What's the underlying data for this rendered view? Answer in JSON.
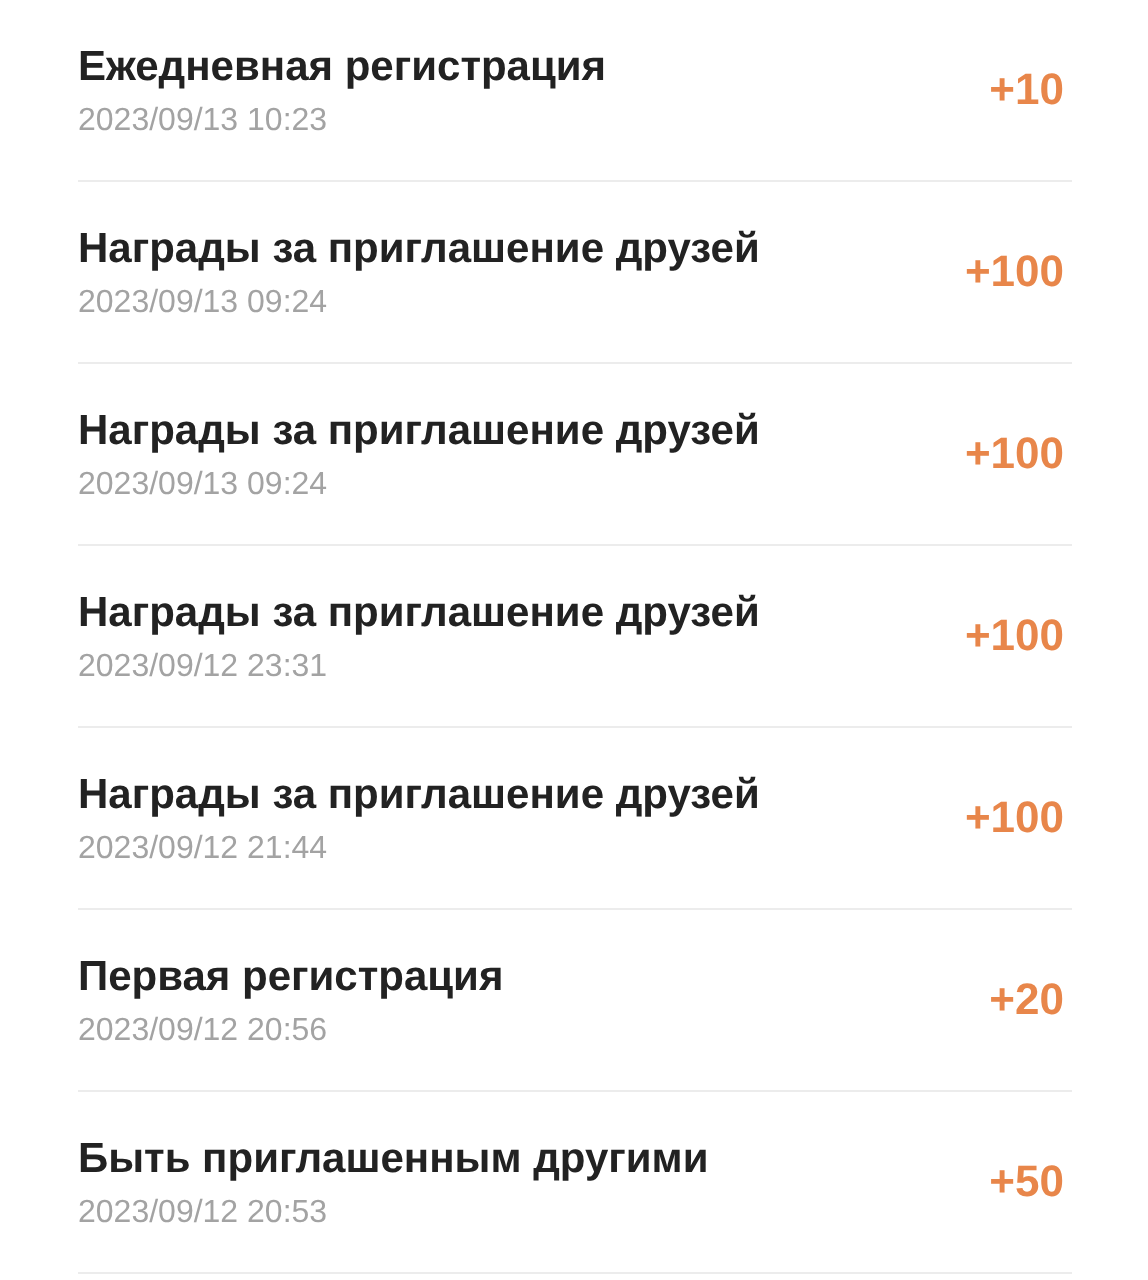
{
  "records": [
    {
      "title": "Ежедневная регистрация",
      "time": "2023/09/13 10:23",
      "points": "+10"
    },
    {
      "title": "Награды за приглашение друзей",
      "time": "2023/09/13 09:24",
      "points": "+100"
    },
    {
      "title": "Награды за приглашение друзей",
      "time": "2023/09/13 09:24",
      "points": "+100"
    },
    {
      "title": "Награды за приглашение друзей",
      "time": "2023/09/12 23:31",
      "points": "+100"
    },
    {
      "title": "Награды за приглашение друзей",
      "time": "2023/09/12 21:44",
      "points": "+100"
    },
    {
      "title": "Первая регистрация",
      "time": "2023/09/12 20:56",
      "points": "+20"
    },
    {
      "title": "Быть приглашенным другими",
      "time": "2023/09/12 20:53",
      "points": "+50"
    }
  ]
}
